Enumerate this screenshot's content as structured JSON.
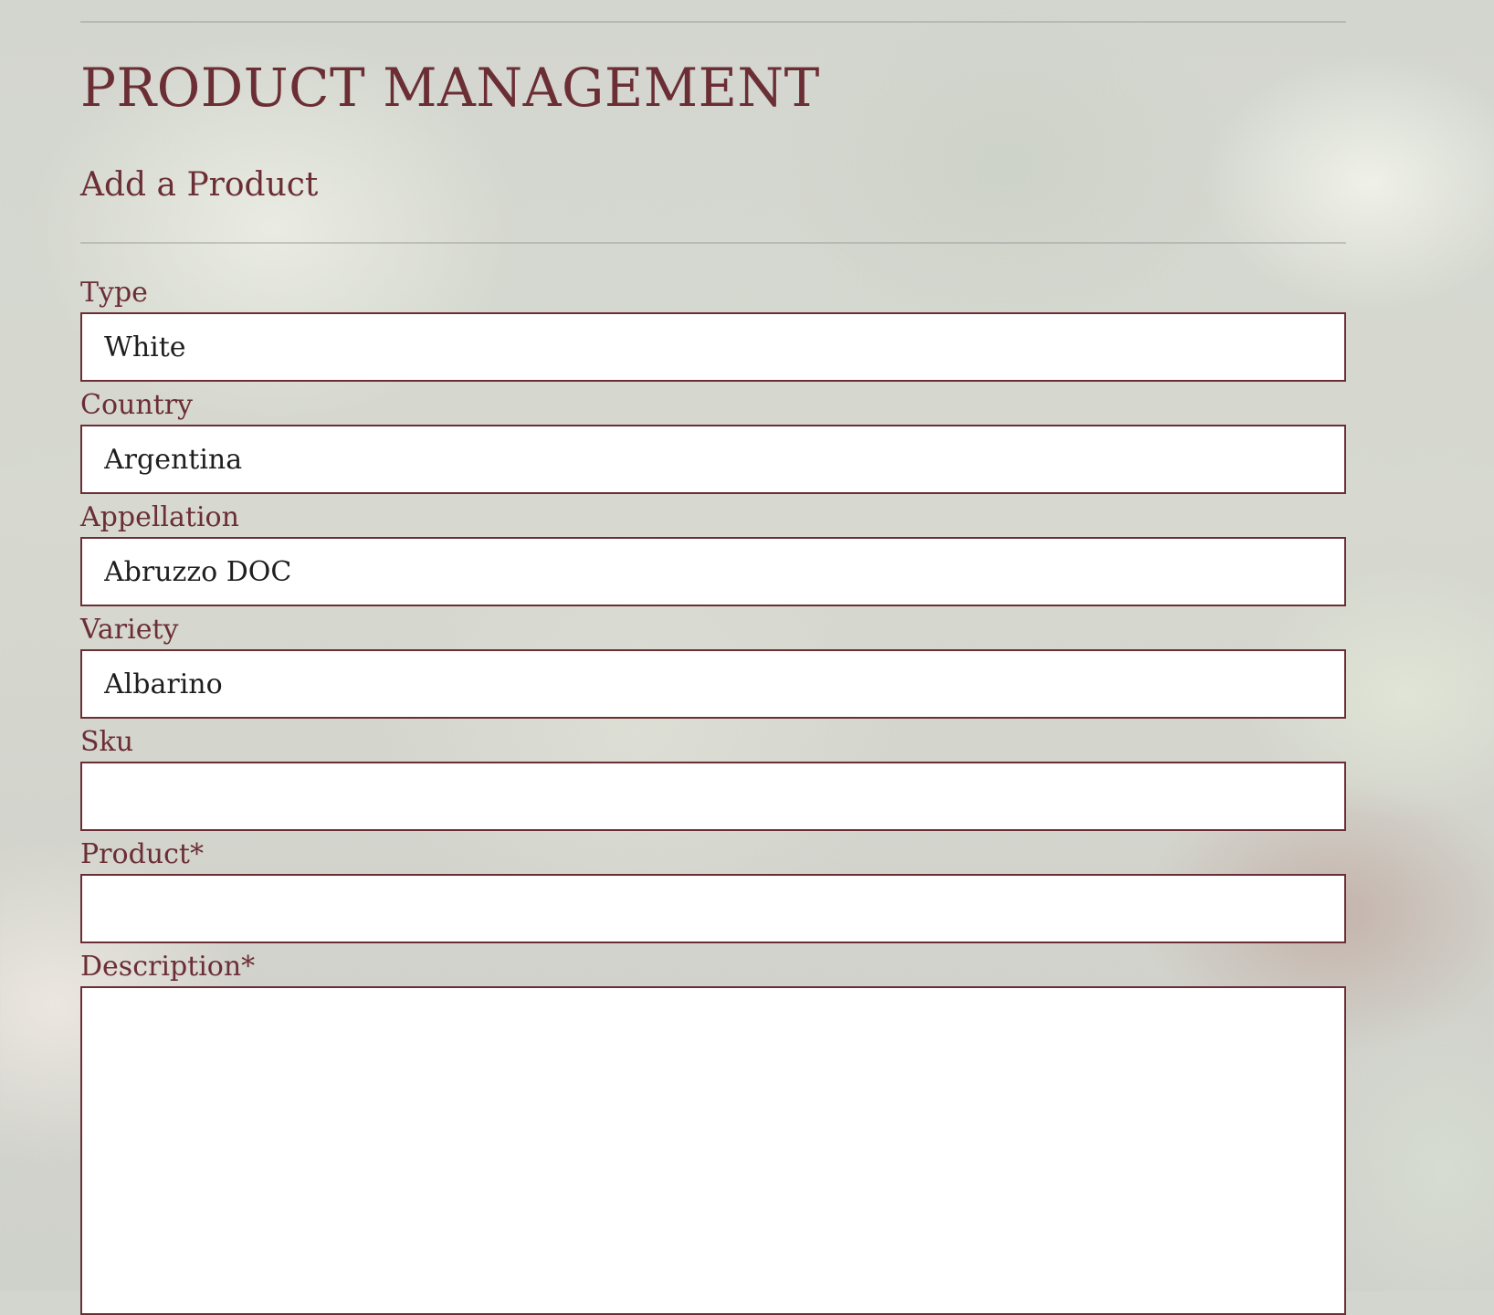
{
  "page": {
    "title": "PRODUCT MANAGEMENT",
    "subtitle": "Add a Product"
  },
  "form": {
    "type": {
      "label": "Type",
      "value": "White"
    },
    "country": {
      "label": "Country",
      "value": "Argentina"
    },
    "appellation": {
      "label": "Appellation",
      "value": "Abruzzo DOC"
    },
    "variety": {
      "label": "Variety",
      "value": "Albarino"
    },
    "sku": {
      "label": "Sku",
      "value": ""
    },
    "product": {
      "label": "Product*",
      "value": ""
    },
    "description": {
      "label": "Description*",
      "value": ""
    }
  },
  "colors": {
    "accent": "#6b2e35",
    "input_background": "#ffffff",
    "rule": "#b4b4b4"
  }
}
